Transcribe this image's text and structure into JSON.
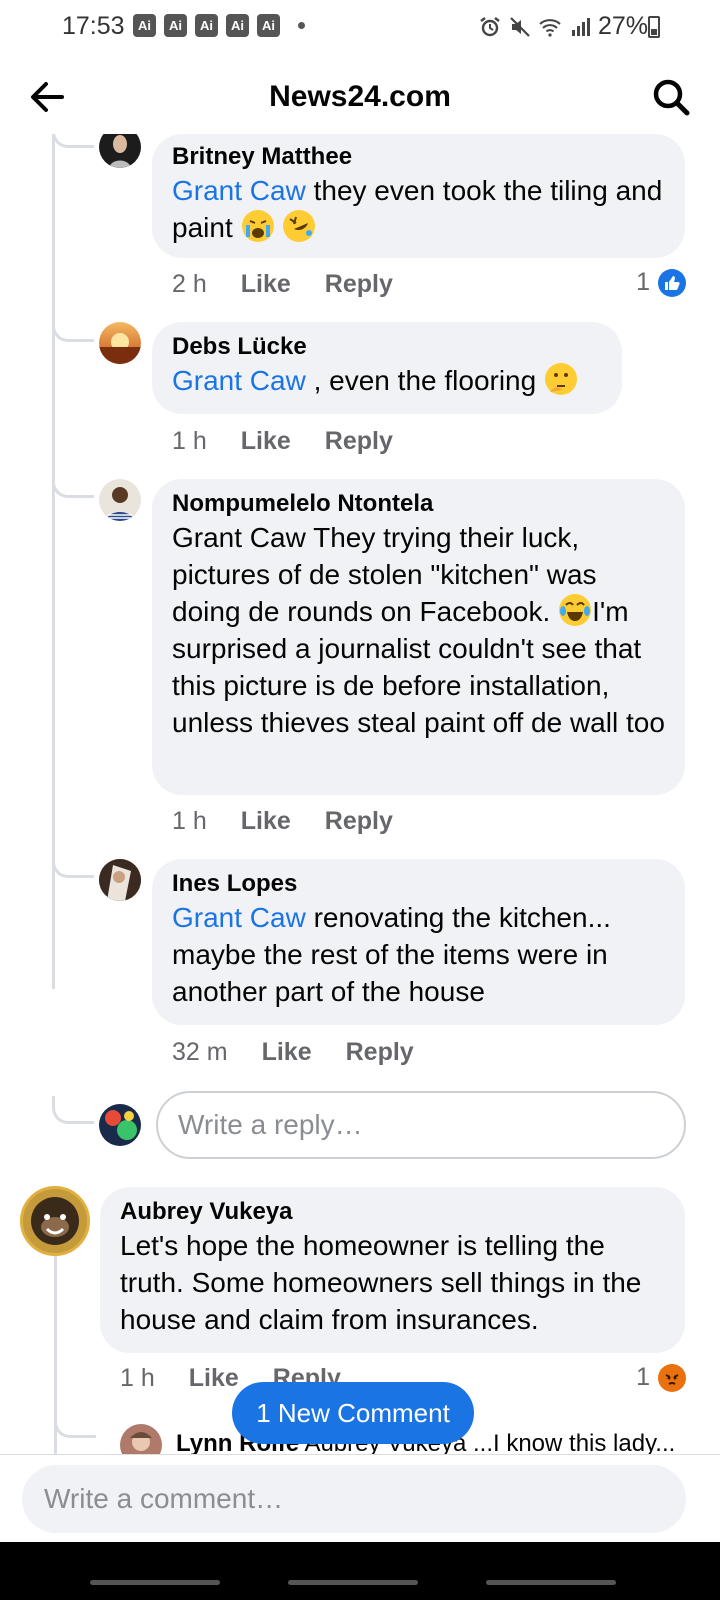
{
  "status_bar": {
    "time": "17:53",
    "ai_badges": [
      "Ai",
      "Ai",
      "Ai",
      "Ai",
      "Ai"
    ],
    "battery": "27%",
    "icons": [
      "alarm-icon",
      "mute-icon",
      "wifi-icon",
      "signal-icon",
      "battery-icon"
    ]
  },
  "header": {
    "title": "News24.com",
    "back_icon": "arrow-left-icon",
    "search_icon": "search-icon"
  },
  "comments": [
    {
      "author": "Britney Matthee",
      "mention": "Grant Caw",
      "text": " they even took the tiling and paint",
      "emojis": [
        "crying-face-emoji",
        "rolling-laughing-emoji"
      ],
      "time": "2 h",
      "like": "Like",
      "reply": "Reply",
      "reaction_count": "1",
      "reaction_icon": "like-reaction-icon"
    },
    {
      "author": "Debs Lücke",
      "mention": "Grant Caw",
      "text": " , even the flooring",
      "emojis": [
        "thinking-face-emoji"
      ],
      "time": "1 h",
      "like": "Like",
      "reply": "Reply"
    },
    {
      "author": "Nompumelelo Ntontela",
      "text_part1": "Grant Caw They trying their luck, pictures of de stolen \"kitchen\" was doing de rounds on Facebook. ",
      "text_part2": "I'm surprised a journalist couldn't see that this picture is de before installation, unless thieves steal paint off de wall too",
      "emojis": [
        "tears-of-joy-emoji"
      ],
      "time": "1 h",
      "like": "Like",
      "reply": "Reply"
    },
    {
      "author": "Ines Lopes",
      "mention": "Grant Caw",
      "text": " renovating the kitchen... maybe the rest of the items were in another part of the house",
      "time": "32 m",
      "like": "Like",
      "reply": "Reply"
    },
    {
      "author": "Aubrey Vukeya",
      "text": "Let's hope the homeowner is telling the truth. Some homeowners sell things in the house and claim from insurances.",
      "time": "1 h",
      "like": "Like",
      "reply": "Reply",
      "reaction_count": "1",
      "reaction_icon": "angry-reaction-icon"
    },
    {
      "author": "Lynn Rolfe",
      "text": "Aubrey Vukeya ...I know this lady..."
    }
  ],
  "reply_placeholder": "Write a reply…",
  "new_comment_pill": "1 New Comment",
  "composer_placeholder": "Write a comment…"
}
